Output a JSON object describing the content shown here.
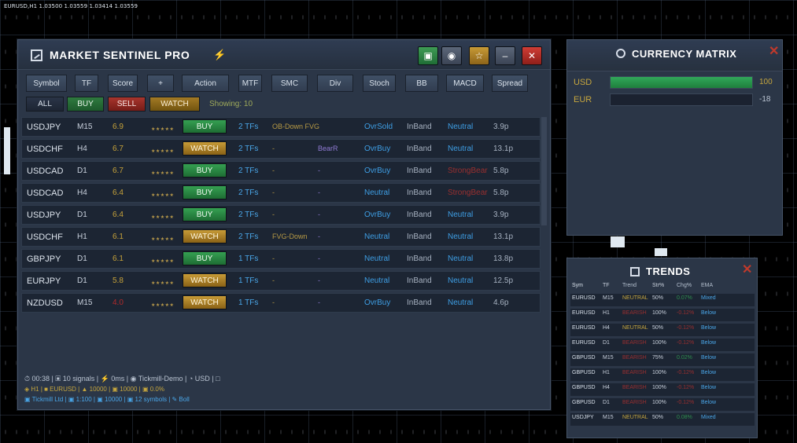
{
  "chart": {
    "title": "EURUSD,H1  1.03500 1.03559 1.03414 1.03559"
  },
  "main": {
    "title": "MARKET SENTINEL PRO",
    "filter_buttons": [
      "Symbol",
      "TF",
      "Score",
      "+",
      "Action",
      "MTF",
      "SMC",
      "Div",
      "Stoch",
      "BB",
      "MACD",
      "Spread"
    ],
    "signal_buttons": {
      "all": "ALL",
      "buy": "BUY",
      "sell": "SELL",
      "watch": "WATCH"
    },
    "showing": "Showing: 10",
    "rows": [
      {
        "sym": "USDJPY",
        "tf": "M15",
        "score": "6.9",
        "stars": "★★★★★",
        "action": "BUY",
        "tfs": "2 TFs",
        "smc": "OB-Down FVG",
        "div": "",
        "stoch": "OvrSold",
        "bb": "InBand",
        "macd": "Neutral",
        "spread": "3.9p"
      },
      {
        "sym": "USDCHF",
        "tf": "H4",
        "score": "6.7",
        "stars": "★★★★★",
        "action": "WATCH",
        "tfs": "2 TFs",
        "smc": "-",
        "div": "BearR",
        "stoch": "OvrBuy",
        "bb": "InBand",
        "macd": "Neutral",
        "spread": "13.1p"
      },
      {
        "sym": "USDCAD",
        "tf": "D1",
        "score": "6.7",
        "stars": "★★★★★",
        "action": "BUY",
        "tfs": "2 TFs",
        "smc": "-",
        "div": "-",
        "stoch": "OvrBuy",
        "bb": "InBand",
        "macd": "StrongBear",
        "spread": "5.8p"
      },
      {
        "sym": "USDCAD",
        "tf": "H4",
        "score": "6.4",
        "stars": "★★★★★",
        "action": "BUY",
        "tfs": "2 TFs",
        "smc": "-",
        "div": "-",
        "stoch": "Neutral",
        "bb": "InBand",
        "macd": "StrongBear",
        "spread": "5.8p"
      },
      {
        "sym": "USDJPY",
        "tf": "D1",
        "score": "6.4",
        "stars": "★★★★★",
        "action": "BUY",
        "tfs": "2 TFs",
        "smc": "-",
        "div": "-",
        "stoch": "OvrBuy",
        "bb": "InBand",
        "macd": "Neutral",
        "spread": "3.9p"
      },
      {
        "sym": "USDCHF",
        "tf": "H1",
        "score": "6.1",
        "stars": "★★★★★",
        "action": "WATCH",
        "tfs": "2 TFs",
        "smc": "FVG-Down",
        "div": "-",
        "stoch": "Neutral",
        "bb": "InBand",
        "macd": "Neutral",
        "spread": "13.1p"
      },
      {
        "sym": "GBPJPY",
        "tf": "D1",
        "score": "6.1",
        "stars": "★★★★★",
        "action": "BUY",
        "tfs": "1 TFs",
        "smc": "-",
        "div": "-",
        "stoch": "Neutral",
        "bb": "InBand",
        "macd": "Neutral",
        "spread": "13.8p"
      },
      {
        "sym": "EURJPY",
        "tf": "D1",
        "score": "5.8",
        "stars": "★★★★★",
        "action": "WATCH",
        "tfs": "1 TFs",
        "smc": "-",
        "div": "-",
        "stoch": "Neutral",
        "bb": "InBand",
        "macd": "Neutral",
        "spread": "12.5p"
      },
      {
        "sym": "NZDUSD",
        "tf": "M15",
        "score": "4.0",
        "stars": "★★★★★",
        "action": "WATCH",
        "tfs": "1 TFs",
        "smc": "-",
        "div": "-",
        "stoch": "OvrBuy",
        "bb": "InBand",
        "macd": "Neutral",
        "spread": "4.6p"
      }
    ],
    "footer": {
      "line1": "⏱ 00:38 | ▣ 10 signals | ⚡ 0ms | ◉ Tickmill-Demo | ◔ USD | □",
      "line2": "◈ H1 | ■ EURUSD | ▲ 10000 | ▣ 10000 | ▣ 0.0%",
      "line3": "▣ Tickmill Ltd | ▣ 1:100 | ▣ 10000 | ▣ 12 symbols | ✎ Boll"
    }
  },
  "currency_matrix": {
    "title": "CURRENCY MATRIX",
    "rows": [
      {
        "label": "USD",
        "value": "100",
        "fill": 1.0,
        "value_color": "#c6a63e"
      },
      {
        "label": "EUR",
        "value": "-18",
        "fill": 0.0,
        "value_color": "#b9c3d1"
      }
    ]
  },
  "trends": {
    "title": "TRENDS",
    "headers": [
      "Sym",
      "TF",
      "Trend",
      "Str%",
      "Chg%",
      "EMA"
    ],
    "rows": [
      {
        "sym": "EURUSD",
        "tf": "M15",
        "trend": "NEUTRAL",
        "str": "50%",
        "chg": "0.07%",
        "ema": "Mixed"
      },
      {
        "sym": "EURUSD",
        "tf": "H1",
        "trend": "BEARISH",
        "str": "100%",
        "chg": "-0.12%",
        "ema": "Below"
      },
      {
        "sym": "EURUSD",
        "tf": "H4",
        "trend": "NEUTRAL",
        "str": "50%",
        "chg": "-0.12%",
        "ema": "Below"
      },
      {
        "sym": "EURUSD",
        "tf": "D1",
        "trend": "BEARISH",
        "str": "100%",
        "chg": "-0.12%",
        "ema": "Below"
      },
      {
        "sym": "GBPUSD",
        "tf": "M15",
        "trend": "BEARISH",
        "str": "75%",
        "chg": "0.02%",
        "ema": "Below"
      },
      {
        "sym": "GBPUSD",
        "tf": "H1",
        "trend": "BEARISH",
        "str": "100%",
        "chg": "-0.12%",
        "ema": "Below"
      },
      {
        "sym": "GBPUSD",
        "tf": "H4",
        "trend": "BEARISH",
        "str": "100%",
        "chg": "-0.12%",
        "ema": "Below"
      },
      {
        "sym": "GBPUSD",
        "tf": "D1",
        "trend": "BEARISH",
        "str": "100%",
        "chg": "-0.12%",
        "ema": "Below"
      },
      {
        "sym": "USDJPY",
        "tf": "M15",
        "trend": "NEUTRAL",
        "str": "50%",
        "chg": "0.08%",
        "ema": "Mixed"
      }
    ]
  }
}
